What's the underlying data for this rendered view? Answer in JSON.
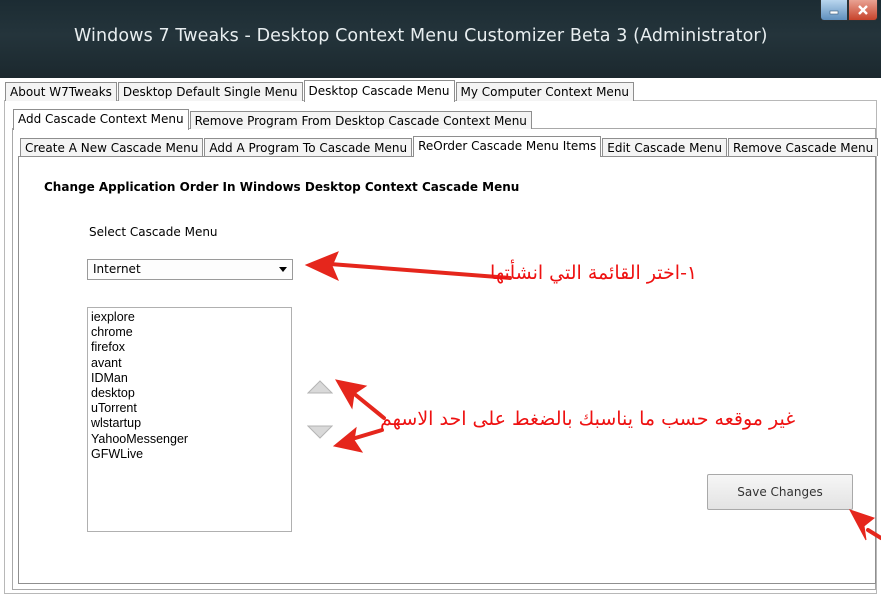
{
  "window": {
    "title": "Windows 7 Tweaks - Desktop Context Menu Customizer Beta 3 (Administrator)"
  },
  "main_tabs": [
    {
      "label": "About W7Tweaks"
    },
    {
      "label": "Desktop Default Single Menu"
    },
    {
      "label": "Desktop Cascade Menu",
      "active": true
    },
    {
      "label": "My Computer Context Menu"
    }
  ],
  "sub_tabs": [
    {
      "label": "Add Cascade Context Menu",
      "active": true
    },
    {
      "label": "Remove Program From Desktop Cascade Context Menu"
    }
  ],
  "inner_tabs": [
    {
      "label": "Create A New Cascade Menu"
    },
    {
      "label": "Add A Program To Cascade Menu"
    },
    {
      "label": "ReOrder Cascade Menu Items",
      "active": true
    },
    {
      "label": "Edit Cascade Menu"
    },
    {
      "label": "Remove Cascade Menu"
    }
  ],
  "panel": {
    "heading": "Change Application Order In Windows Desktop Context Cascade Menu",
    "select_label": "Select Cascade Menu",
    "select_value": "Internet",
    "list_items": [
      "iexplore",
      "chrome",
      "firefox",
      "avant",
      "IDMan",
      "desktop",
      "uTorrent",
      "wlstartup",
      "YahooMessenger",
      "GFWLive"
    ],
    "move_up_icon": "triangle-up-icon",
    "move_down_icon": "triangle-down-icon",
    "save_label": "Save Changes"
  },
  "annotations": {
    "note_select": "١-اختر القائمة التي انشأتها",
    "note_order": "غير موقعه حسب ما يناسبك بالضغط على احد الاسهم",
    "color": "#ee1111"
  },
  "colors": {
    "titlebar": "#1f2e35",
    "close_button": "#c7432b",
    "minimize_button": "#5f8fbd"
  }
}
